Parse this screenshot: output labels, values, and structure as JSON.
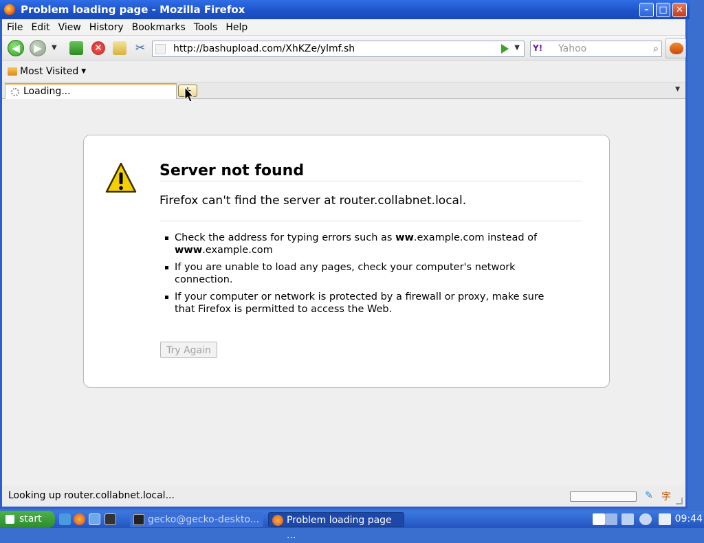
{
  "window": {
    "title": "Problem loading page - Mozilla Firefox",
    "controls": {
      "minimize": "–",
      "maximize": "□",
      "close": "✕"
    }
  },
  "menubar": {
    "items": [
      "File",
      "Edit",
      "View",
      "History",
      "Bookmarks",
      "Tools",
      "Help"
    ]
  },
  "navbar": {
    "url": "http://bashupload.com/XhKZe/ylmf.sh",
    "search_placeholder": "Yahoo",
    "search_engine": "Y!"
  },
  "bookmarks_bar": {
    "most_visited": "Most Visited"
  },
  "tabs": {
    "active_label": "Loading...",
    "new_tab_glyph": "+"
  },
  "error_page": {
    "title": "Server not found",
    "short_desc": "Firefox can't find the server at router.collabnet.local.",
    "items": [
      {
        "pre": "Check the address for typing errors such as ",
        "bold1": "ww",
        "mid": ".example.com instead of ",
        "bold2": "www",
        "post": ".example.com"
      },
      {
        "text": "If you are unable to load any pages, check your computer's network connection."
      },
      {
        "text": "If your computer or network is protected by a firewall or proxy, make sure that Firefox is permitted to access the Web."
      }
    ],
    "try_again": "Try Again"
  },
  "statusbar": {
    "text": "Looking up router.collabnet.local...",
    "ime_glyph": "字"
  },
  "taskbar": {
    "start": "start",
    "tasks": [
      "gecko@gecko-deskto...",
      "Problem loading page ..."
    ],
    "clock": "09:44"
  },
  "colors": {
    "titlebar": "#1d52c8",
    "taskbar": "#2454c0",
    "start_button": "#2e8a2c",
    "tab_loading_accent": "#f0a030"
  }
}
